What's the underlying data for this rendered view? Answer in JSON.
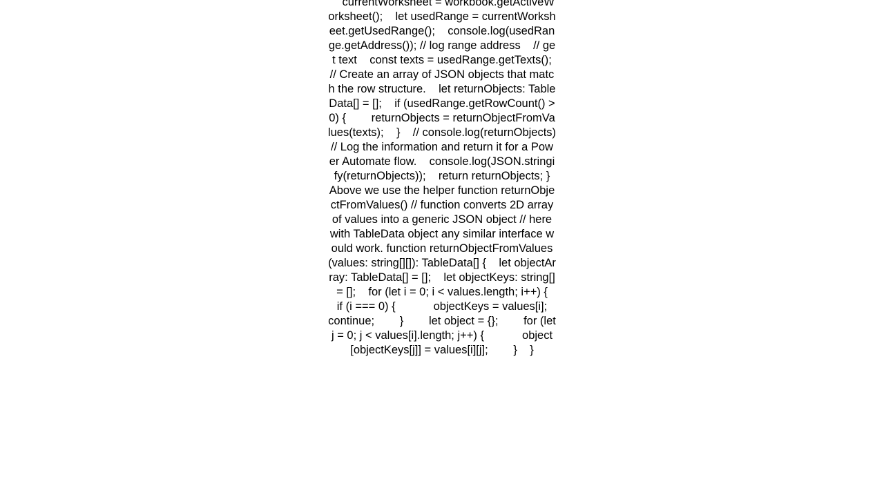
{
  "page": {
    "background_color": "#ffffff",
    "text_color": "#000000",
    "alignment": "center"
  },
  "code_block": {
    "language": "typescript",
    "body": "    currentWorksheet = workbook.getActiveWorksheet();    let usedRange = currentWorksheet.getUsedRange();    console.log(usedRange.getAddress()); // log range address    // get text    const texts = usedRange.getTexts();    // Create an array of JSON objects that match the row structure.    let returnObjects: TableData[] = [];    if (usedRange.getRowCount() > 0) {        returnObjects = returnObjectFromValues(texts);    }    // console.log(returnObjects)    // Log the information and return it for a Power Automate flow.    console.log(JSON.stringify(returnObjects));    return returnObjects; }  Above we use the helper function returnObjectFromValues() // function converts 2D array of values into a generic JSON object // here with TableData object any similar interface would work. function returnObjectFromValues(values: string[][]): TableData[] {    let objectArray: TableData[] = [];    let objectKeys: string[] = [];    for (let i = 0; i < values.length; i++) {        if (i === 0) {            objectKeys = values[i];            continue;        }        let object = {};        for (let j = 0; j < values[i].length; j++) {            object[objectKeys[j]] = values[i][j];        }    }"
  }
}
